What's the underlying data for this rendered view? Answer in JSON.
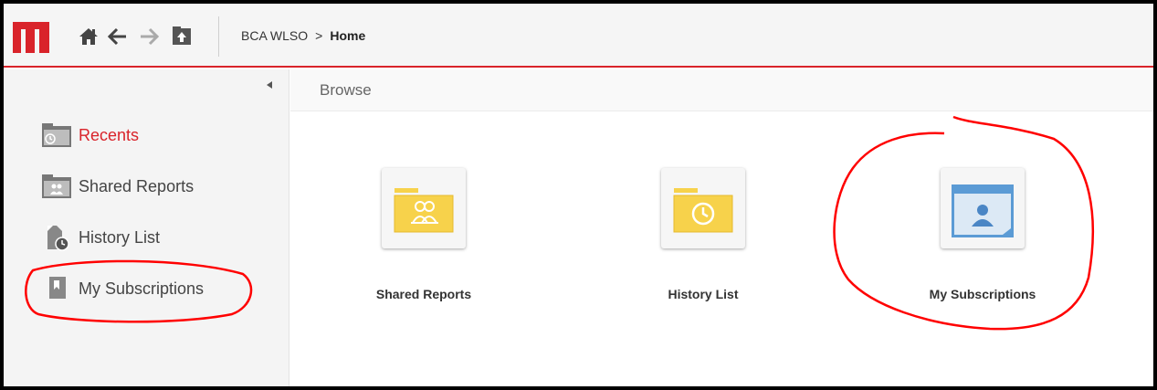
{
  "header": {
    "breadcrumb": {
      "project": "BCA WLSO",
      "separator": ">",
      "current": "Home"
    }
  },
  "sidebar": {
    "items": [
      {
        "label": "Recents",
        "icon": "recents-folder-icon",
        "active": true
      },
      {
        "label": "Shared Reports",
        "icon": "shared-reports-folder-icon",
        "active": false
      },
      {
        "label": "History List",
        "icon": "history-list-icon",
        "active": false
      },
      {
        "label": "My Subscriptions",
        "icon": "subscriptions-icon",
        "active": false
      }
    ]
  },
  "main": {
    "title": "Browse",
    "tiles": [
      {
        "label": "Shared Reports",
        "icon": "shared-reports-folder-icon"
      },
      {
        "label": "History List",
        "icon": "history-folder-icon"
      },
      {
        "label": "My Subscriptions",
        "icon": "subscriptions-icon"
      }
    ]
  },
  "colors": {
    "brand_red": "#d9232a",
    "folder_yellow": "#f7d24b",
    "subscription_blue": "#5b9bd5",
    "annotation_red": "#ff0000"
  }
}
